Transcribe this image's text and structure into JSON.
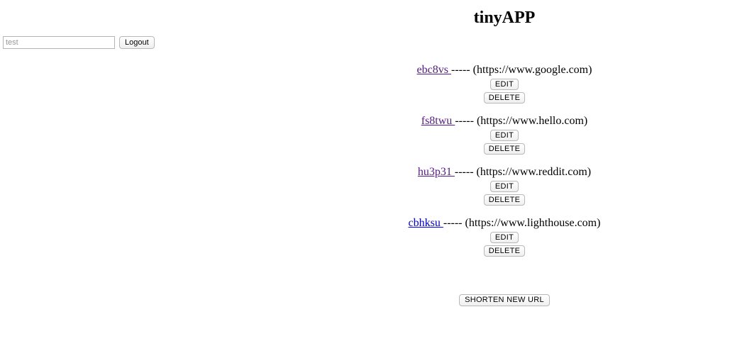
{
  "header": {
    "title": "tinyAPP"
  },
  "login": {
    "username_value": "",
    "username_placeholder": "test",
    "logout_label": "Logout"
  },
  "urls": [
    {
      "short": "ebc8vs ",
      "separator": "----- ",
      "long": "(https://www.google.com)",
      "visited": true
    },
    {
      "short": "fs8twu ",
      "separator": "----- ",
      "long": "(https://www.hello.com)",
      "visited": true
    },
    {
      "short": "hu3p31 ",
      "separator": "----- ",
      "long": "(https://www.reddit.com)",
      "visited": true
    },
    {
      "short": "cbhksu ",
      "separator": "----- ",
      "long": "(https://www.lighthouse.com)",
      "visited": false
    }
  ],
  "buttons": {
    "edit_label": "EDIT",
    "delete_label": "DELETE",
    "shorten_label": "SHORTEN NEW URL"
  },
  "colors": {
    "visited_link": "#551a8b",
    "unvisited_link": "#0000ee"
  }
}
